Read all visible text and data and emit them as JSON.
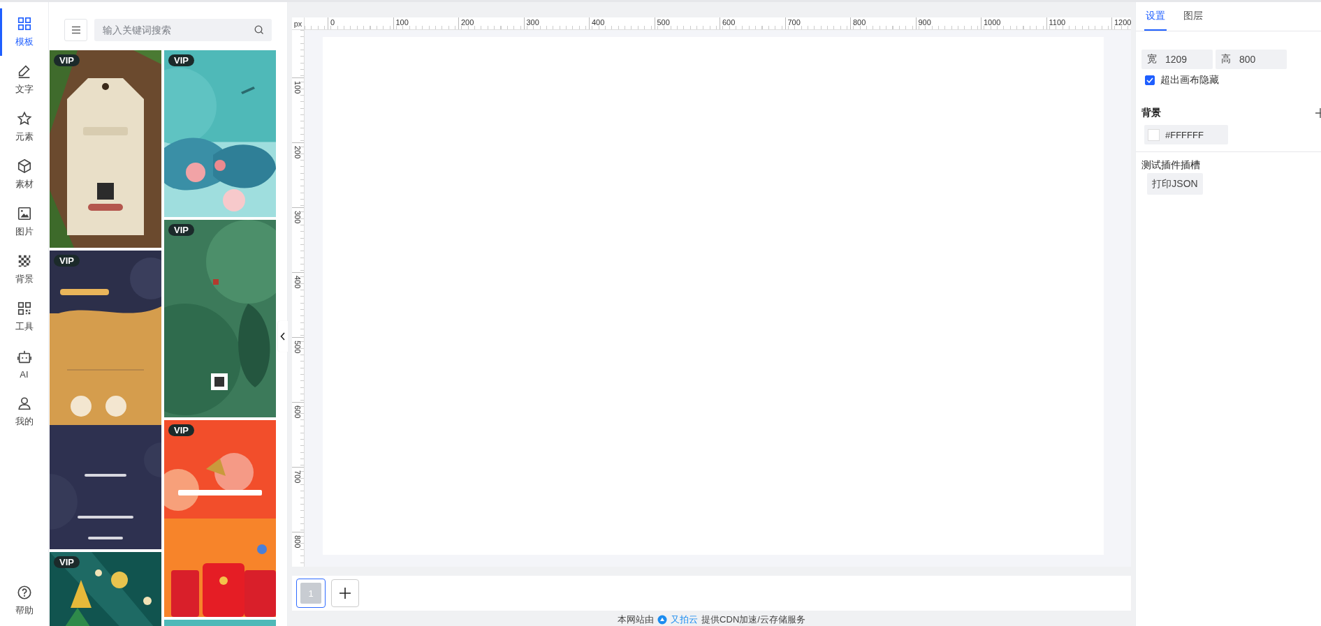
{
  "nav": {
    "items": [
      {
        "label": "模板",
        "selected": true
      },
      {
        "label": "文字",
        "selected": false
      },
      {
        "label": "元素",
        "selected": false
      },
      {
        "label": "素材",
        "selected": false
      },
      {
        "label": "图片",
        "selected": false
      },
      {
        "label": "背景",
        "selected": false
      },
      {
        "label": "工具",
        "selected": false
      },
      {
        "label": "AI",
        "selected": false
      },
      {
        "label": "我的",
        "selected": false
      }
    ],
    "help": {
      "label": "帮助"
    }
  },
  "template_panel": {
    "search": {
      "placeholder": "输入关键词搜索"
    },
    "columns": [
      [
        {
          "kind": "picture",
          "badge": "VIP"
        },
        {
          "kind": "picture",
          "badge": "VIP"
        },
        {
          "kind": "picture",
          "badge": "VIP"
        }
      ],
      [
        {
          "kind": "picture",
          "badge": "VIP"
        },
        {
          "kind": "picture",
          "badge": "VIP"
        },
        {
          "kind": "picture",
          "badge": "VIP"
        },
        {
          "kind": "picture"
        }
      ]
    ]
  },
  "canvas": {
    "unit": "px",
    "x_labels": [
      "0",
      "100",
      "200",
      "300",
      "400",
      "500",
      "600",
      "700",
      "800",
      "900",
      "1000",
      "1100",
      "1200"
    ],
    "y_labels": [
      "100",
      "200",
      "300",
      "400",
      "500",
      "600",
      "700",
      "800"
    ],
    "pages": [
      {
        "label": "1",
        "selected": true
      }
    ]
  },
  "footer": {
    "before": "本网站由",
    "brand": "又拍云",
    "after": "提供CDN加速/云存储服务"
  },
  "settings": {
    "tabs": [
      {
        "label": "设置",
        "selected": true
      },
      {
        "label": "图层",
        "selected": false
      }
    ],
    "width": {
      "label": "宽",
      "value": "1209"
    },
    "height": {
      "label": "高",
      "value": "800"
    },
    "clip": {
      "label": "超出画布隐藏",
      "checked": true
    },
    "background": {
      "title": "背景",
      "color": "#ffffff",
      "value": "#FFFFFF"
    },
    "plugin": {
      "title": "测试插件插槽",
      "button": "打印JSON"
    }
  }
}
